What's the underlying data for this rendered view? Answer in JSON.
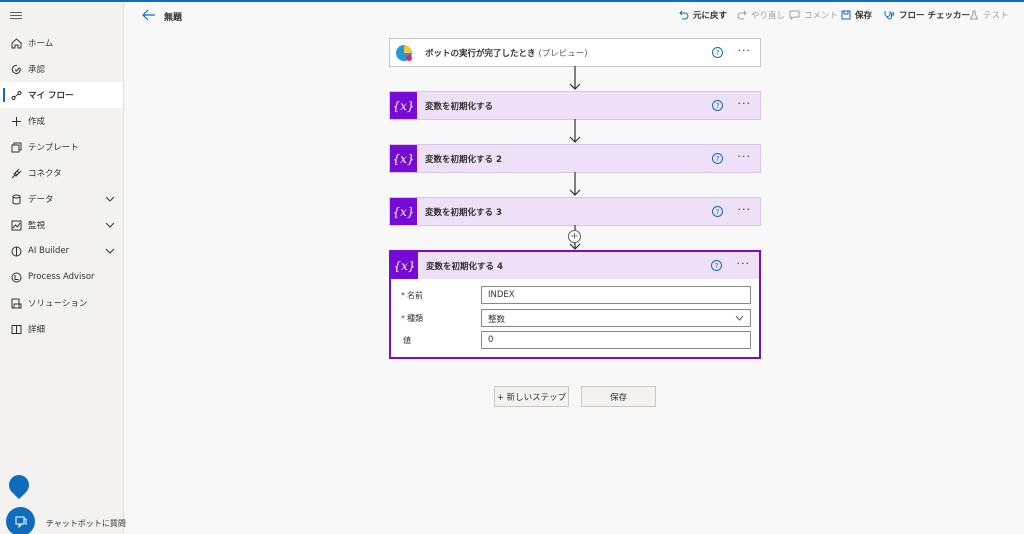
{
  "header": {
    "title": "無題",
    "undo": "元に戻す",
    "redo": "やり直し",
    "comment": "コメント",
    "save": "保存",
    "checker": "フロー チェッカー",
    "test": "テスト"
  },
  "sidebar": {
    "items": [
      {
        "label": "ホーム",
        "icon": "home-icon"
      },
      {
        "label": "承認",
        "icon": "approvals-icon"
      },
      {
        "label": "マイ フロー",
        "icon": "flow-icon"
      },
      {
        "label": "作成",
        "icon": "plus-icon"
      },
      {
        "label": "テンプレート",
        "icon": "template-icon"
      },
      {
        "label": "コネクタ",
        "icon": "connector-icon"
      },
      {
        "label": "データ",
        "icon": "database-icon"
      },
      {
        "label": "監視",
        "icon": "monitor-icon"
      },
      {
        "label": "AI Builder",
        "icon": "ai-builder-icon"
      },
      {
        "label": "Process Advisor",
        "icon": "process-advisor-icon"
      },
      {
        "label": "ソリューション",
        "icon": "solution-icon"
      },
      {
        "label": "詳細",
        "icon": "book-icon"
      }
    ],
    "chatbot_label": "チャットボットに質問"
  },
  "flow": {
    "trigger": {
      "title": "ボットの実行が完了したとき",
      "suffix": "(プレビュー)"
    },
    "var_icon": "{x}",
    "steps": [
      "変数を初期化する",
      "変数を初期化する 2",
      "変数を初期化する 3"
    ],
    "expanded": {
      "title": "変数を初期化する 4",
      "fields": [
        {
          "label": "名前",
          "required": "*",
          "value": "INDEX"
        },
        {
          "label": "種類",
          "required": "*",
          "value": "整数"
        },
        {
          "label": "値",
          "required": "",
          "value": "0"
        }
      ]
    },
    "new_step": "+ 新しいステップ",
    "save": "保存"
  },
  "colors": {
    "accent": "#0f6cbd",
    "variable": "#770bd6",
    "variable_bg": "#ede0f7"
  }
}
